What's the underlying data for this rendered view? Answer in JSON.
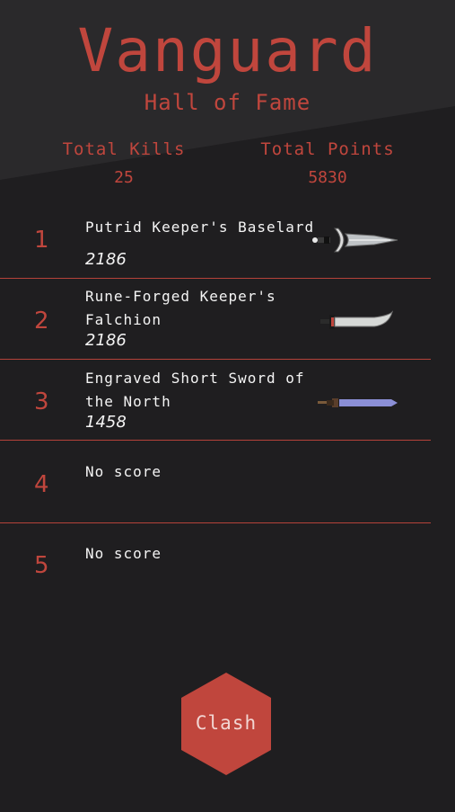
{
  "header": {
    "title": "Vanguard",
    "subtitle": "Hall of Fame"
  },
  "stats": {
    "kills_label": "Total Kills",
    "kills_value": "25",
    "points_label": "Total Points",
    "points_value": "5830"
  },
  "leaderboard": [
    {
      "rank": "1",
      "name": "Putrid Keeper's Baselard",
      "score": "2186",
      "weapon_icon": "dagger-icon"
    },
    {
      "rank": "2",
      "name": "Rune-Forged Keeper's Falchion",
      "score": "2186",
      "weapon_icon": "falchion-icon"
    },
    {
      "rank": "3",
      "name": "Engraved Short Sword of the North",
      "score": "1458",
      "weapon_icon": "short-sword-icon"
    },
    {
      "rank": "4",
      "name": "No score",
      "score": ""
    },
    {
      "rank": "5",
      "name": "No score",
      "score": ""
    }
  ],
  "actions": {
    "clash_label": "Clash"
  },
  "colors": {
    "accent": "#c0463d",
    "background": "#1f1e20",
    "text": "#f4f4f4"
  }
}
